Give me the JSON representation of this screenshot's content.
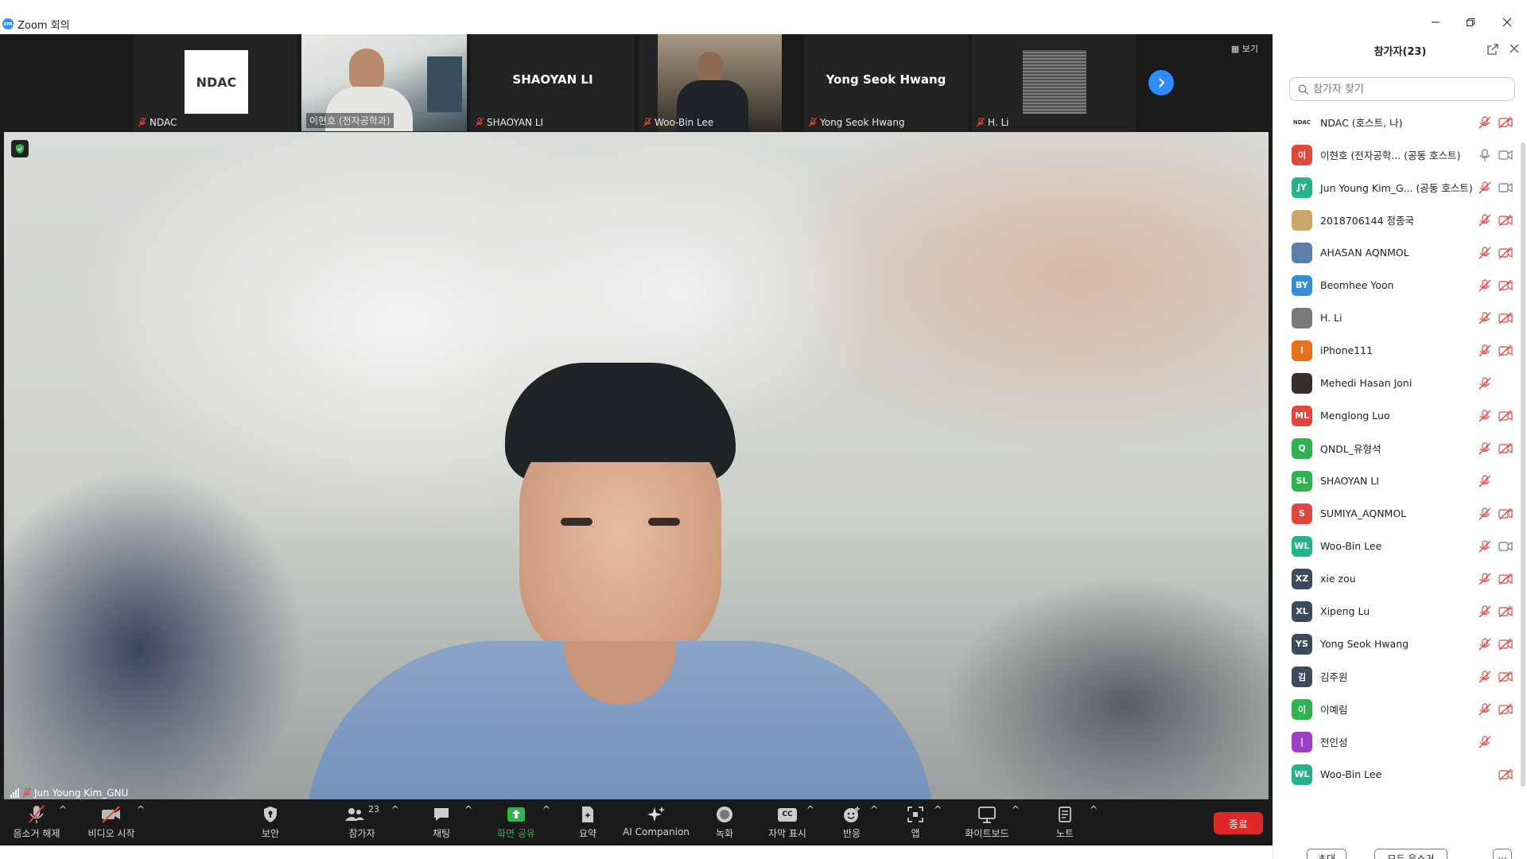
{
  "window": {
    "title": "Zoom 회의",
    "logo_text": "zm"
  },
  "strip": {
    "view_label": "▦ 보기",
    "thumbs": [
      {
        "name": "NDAC",
        "logo_text": "NDAC"
      },
      {
        "name": "이현호 (전자공학과)"
      },
      {
        "name": "SHAOYAN LI",
        "big": "SHAOYAN LI"
      },
      {
        "name": "Woo-Bin Lee"
      },
      {
        "name": "Yong Seok Hwang",
        "big": "Yong Seok Hwang"
      },
      {
        "name": "H. Li"
      }
    ]
  },
  "main": {
    "speaker_name": "Jun Young Kim_GNU"
  },
  "toolbar": {
    "unmute": "음소거 해제",
    "start_video": "비디오 시작",
    "security": "보안",
    "participants": "참가자",
    "participants_count": "23",
    "chat": "채팅",
    "share": "화면 공유",
    "summary": "요약",
    "ai": "AI Companion",
    "record": "녹화",
    "captions": "자막 표시",
    "captions_icon": "CC",
    "reactions": "반응",
    "apps": "앱",
    "whiteboard": "화이트보드",
    "notes": "노트",
    "end": "종료"
  },
  "panel": {
    "title": "참가자(23)",
    "search_placeholder": "참가자 찾기",
    "invite": "초대",
    "mute_all": "모두 음소거",
    "more": "···",
    "participants": [
      {
        "name": "NDAC (호스트, 나)",
        "avatar": "NDAC",
        "color": "#ffffff",
        "mic": "muted",
        "cam": "off"
      },
      {
        "name": "이현호 (전자공학... (공동 호스트)",
        "avatar": "이",
        "color": "#e0483e",
        "mic": "on",
        "cam": "on"
      },
      {
        "name": "Jun Young Kim_G... (공동 호스트)",
        "avatar": "JY",
        "color": "#27b38a",
        "mic": "muted",
        "cam": "on"
      },
      {
        "name": "2018706144 정종국",
        "avatar": "",
        "color": "#c9a66b",
        "mic": "muted",
        "cam": "off"
      },
      {
        "name": "AHASAN  AQNMOL",
        "avatar": "",
        "color": "#5b7fa8",
        "mic": "muted",
        "cam": "off"
      },
      {
        "name": "Beomhee Yoon",
        "avatar": "BY",
        "color": "#3a8ed6",
        "mic": "muted",
        "cam": "off"
      },
      {
        "name": "H. Li",
        "avatar": "",
        "color": "#7a7a7a",
        "mic": "muted",
        "cam": "off"
      },
      {
        "name": "iPhone111",
        "avatar": "I",
        "color": "#e8701a",
        "mic": "muted",
        "cam": "off"
      },
      {
        "name": "Mehedi Hasan Joni",
        "avatar": "",
        "color": "#3b2d2a",
        "mic": "muted",
        "cam": "none"
      },
      {
        "name": "Menglong Luo",
        "avatar": "ML",
        "color": "#e0483e",
        "mic": "muted",
        "cam": "off"
      },
      {
        "name": "QNDL_유형석",
        "avatar": "Q",
        "color": "#2fb350",
        "mic": "muted",
        "cam": "off"
      },
      {
        "name": "SHAOYAN LI",
        "avatar": "SL",
        "color": "#2fb350",
        "mic": "muted",
        "cam": "none"
      },
      {
        "name": "SUMIYA_AQNMOL",
        "avatar": "S",
        "color": "#e0483e",
        "mic": "muted",
        "cam": "off"
      },
      {
        "name": "Woo-Bin Lee",
        "avatar": "WL",
        "color": "#27b38a",
        "mic": "muted",
        "cam": "on"
      },
      {
        "name": "xie zou",
        "avatar": "XZ",
        "color": "#3b4a5c",
        "mic": "muted",
        "cam": "off"
      },
      {
        "name": "Xipeng Lu",
        "avatar": "XL",
        "color": "#3b4a5c",
        "mic": "muted",
        "cam": "off"
      },
      {
        "name": "Yong Seok Hwang",
        "avatar": "YS",
        "color": "#3b4a5c",
        "mic": "muted",
        "cam": "off"
      },
      {
        "name": "김주원",
        "avatar": "김",
        "color": "#3b4a5c",
        "mic": "muted",
        "cam": "off"
      },
      {
        "name": "이예림",
        "avatar": "이",
        "color": "#2fb350",
        "mic": "muted",
        "cam": "off"
      },
      {
        "name": "전인성",
        "avatar": "|",
        "color": "#9b3fc7",
        "mic": "muted",
        "cam": "none"
      },
      {
        "name": "Woo-Bin Lee",
        "avatar": "WL",
        "color": "#27b38a",
        "mic": "none",
        "cam": "off"
      }
    ]
  }
}
